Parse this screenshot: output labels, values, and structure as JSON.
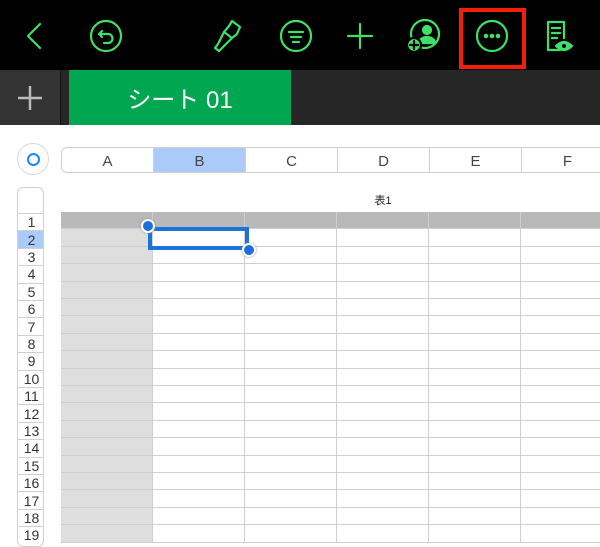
{
  "toolbar": {
    "icons": [
      "back-chevron-icon",
      "undo-icon",
      "format-brush-icon",
      "filter-icon",
      "add-icon",
      "collaborate-icon",
      "more-icon",
      "reading-view-icon"
    ],
    "accent": "#3ee06a",
    "highlight": "#f41e0b"
  },
  "sheets": {
    "add_icon": "plus-icon",
    "tabs": [
      {
        "label": "シート 01",
        "active": true
      }
    ]
  },
  "table": {
    "title": "表1",
    "columns": [
      "A",
      "B",
      "C",
      "D",
      "E",
      "F"
    ],
    "selected_column": "B",
    "rows": [
      "1",
      "2",
      "3",
      "4",
      "5",
      "6",
      "7",
      "8",
      "9",
      "10",
      "11",
      "12",
      "13",
      "14",
      "15",
      "16",
      "17",
      "18",
      "19"
    ],
    "selected_row": "2",
    "selected_cell": "B2"
  }
}
